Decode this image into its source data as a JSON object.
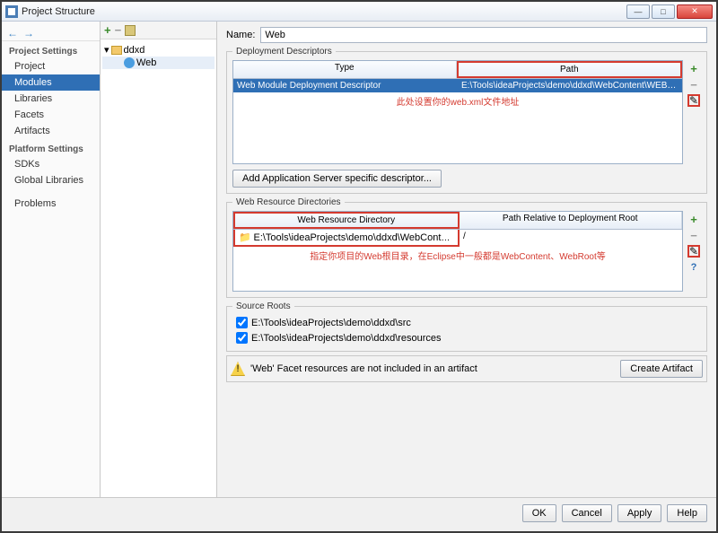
{
  "window": {
    "title": "Project Structure"
  },
  "sidebar": {
    "groups": [
      {
        "title": "Project Settings",
        "items": [
          "Project",
          "Modules",
          "Libraries",
          "Facets",
          "Artifacts"
        ],
        "selected": 1
      },
      {
        "title": "Platform Settings",
        "items": [
          "SDKs",
          "Global Libraries"
        ],
        "selected": -1
      },
      {
        "title": "",
        "items": [
          "Problems"
        ],
        "selected": -1
      }
    ]
  },
  "tree": {
    "root": "ddxd",
    "child": "Web"
  },
  "form": {
    "name_label": "Name:",
    "name_value": "Web"
  },
  "deployment": {
    "legend": "Deployment Descriptors",
    "columns": [
      "Type",
      "Path"
    ],
    "row": {
      "type": "Web Module Deployment Descriptor",
      "path": "E:\\Tools\\ideaProjects\\demo\\ddxd\\WebContent\\WEB-INF\\web."
    },
    "note": "此处设置你的web.xml文件地址",
    "add_btn": "Add Application Server specific descriptor..."
  },
  "webres": {
    "legend": "Web Resource Directories",
    "columns": [
      "Web Resource Directory",
      "Path Relative to Deployment Root"
    ],
    "row": {
      "dir": "E:\\Tools\\ideaProjects\\demo\\ddxd\\WebContent",
      "rel": "/"
    },
    "note": "指定你项目的Web根目录，在Eclipse中一般都是WebContent、WebRoot等"
  },
  "srcroots": {
    "legend": "Source Roots",
    "items": [
      "E:\\Tools\\ideaProjects\\demo\\ddxd\\src",
      "E:\\Tools\\ideaProjects\\demo\\ddxd\\resources"
    ]
  },
  "warning": {
    "text": "'Web' Facet resources are not included in an artifact",
    "button": "Create Artifact"
  },
  "footer": {
    "ok": "OK",
    "cancel": "Cancel",
    "apply": "Apply",
    "help": "Help"
  }
}
